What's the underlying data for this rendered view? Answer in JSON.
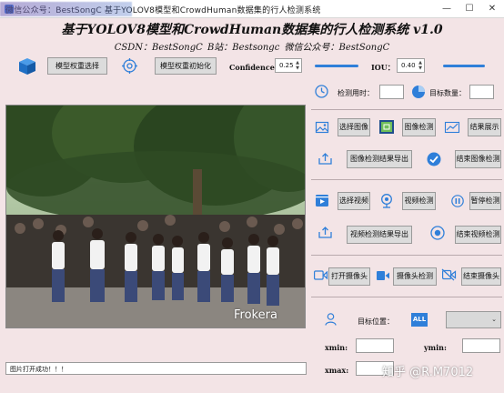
{
  "window": {
    "title": "微信公众号：BestSongC 基于YOLOV8模型和CrowdHuman数据集的行人检测系统",
    "minimize": "—",
    "maximize": "☐",
    "close": "✕"
  },
  "header": {
    "title": "基于YOLOV8模型和CrowdHuman数据集的行人检测系统 v1.0",
    "subtitle": "CSDN：BestSongC   B站：Bestsongc   微信公众号：BestSongC"
  },
  "toolbar": {
    "select_weights": "模型权重选择",
    "init_weights": "模型权重初始化",
    "confidence_label": "Confidence:",
    "confidence_value": "0.25",
    "iou_label": "IOU：",
    "iou_value": "0.40"
  },
  "stats": {
    "time_label": "检测用时：",
    "count_label": "目标数量："
  },
  "image_section": {
    "select_image": "选择图像",
    "detect_image": "图像检测",
    "show_result": "结果展示",
    "export_image": "图像检测结果导出",
    "end_image": "结束图像检测"
  },
  "video_section": {
    "select_video": "选择视频",
    "detect_video": "视频检测",
    "pause": "暂停检测",
    "export_video": "视频检测结果导出",
    "end_video": "结束视频检测"
  },
  "camera_section": {
    "open_camera": "打开摄像头",
    "detect_camera": "摄像头检测",
    "close_camera": "结束摄像头"
  },
  "target": {
    "position_label": "目标位置：",
    "all_badge": "ALL",
    "xmin_label": "xmin:",
    "ymin_label": "ymin:",
    "xmax_label": "xmax:"
  },
  "status_text": "图片打开成功！！！",
  "watermarks": {
    "image": "Frokera",
    "corner": "知乎 @R.M7012"
  },
  "colors": {
    "background": "#f3e4e6",
    "accent": "#2f7fd9",
    "button_gray": "#dcdcdc"
  }
}
